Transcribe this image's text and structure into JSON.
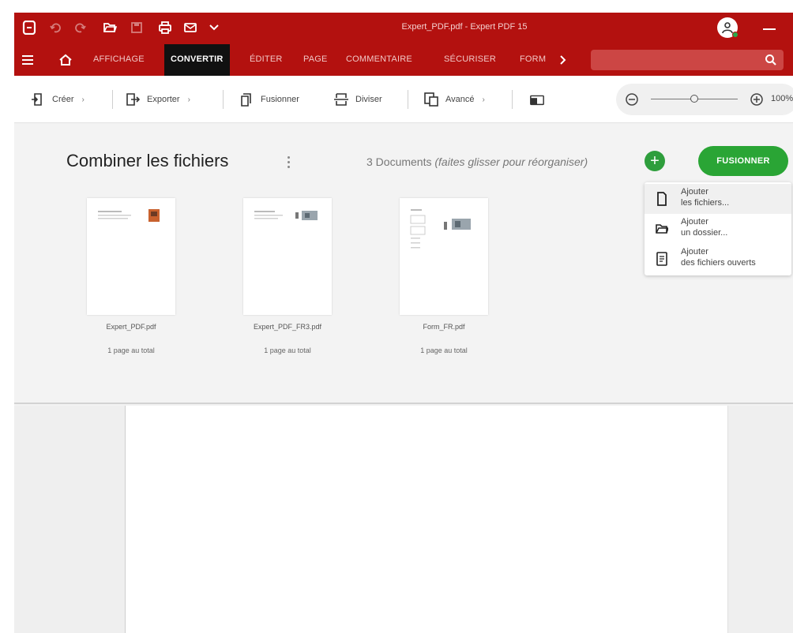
{
  "window": {
    "title": "Expert_PDF.pdf  -  Expert PDF 15",
    "brand_color": "#b3110f",
    "accent_color": "#2aa535"
  },
  "quick_access": [
    {
      "icon": "app-logo-icon"
    },
    {
      "icon": "undo-icon"
    },
    {
      "icon": "redo-icon"
    },
    {
      "icon": "open-folder-icon"
    },
    {
      "icon": "save-icon"
    },
    {
      "icon": "print-icon"
    },
    {
      "icon": "email-icon"
    },
    {
      "icon": "chevron-down-icon"
    }
  ],
  "menu": {
    "tabs": [
      "AFFICHAGE",
      "CONVERTIR",
      "ÉDITER",
      "PAGE",
      "COMMENTAIRE",
      "SÉCURISER",
      "FORM"
    ],
    "active_tab": "CONVERTIR",
    "more_icon": "chevron-right-icon"
  },
  "toolbar": {
    "create": "Créer",
    "export": "Exporter",
    "merge": "Fusionner",
    "split": "Diviser",
    "advanced": "Avancé",
    "zoom_level": "100%"
  },
  "combine": {
    "title": "Combiner les fichiers",
    "count": "3 Documents",
    "hint": "(faites glisser pour réorganiser)",
    "add_icon": "plus-icon",
    "merge_button": "FUSIONNER",
    "menu": [
      {
        "line1": "Ajouter",
        "line2": "les fichiers...",
        "icon": "file-icon"
      },
      {
        "line1": "Ajouter",
        "line2": "un dossier...",
        "icon": "folder-icon"
      },
      {
        "line1": "Ajouter",
        "line2": "des fichiers ouverts",
        "icon": "open-document-icon"
      }
    ],
    "files": [
      {
        "name": "Expert_PDF.pdf",
        "pages": "1 page au total"
      },
      {
        "name": "Expert_PDF_FR3.pdf",
        "pages": "1 page au total"
      },
      {
        "name": "Form_FR.pdf",
        "pages": "1 page au total"
      }
    ]
  }
}
